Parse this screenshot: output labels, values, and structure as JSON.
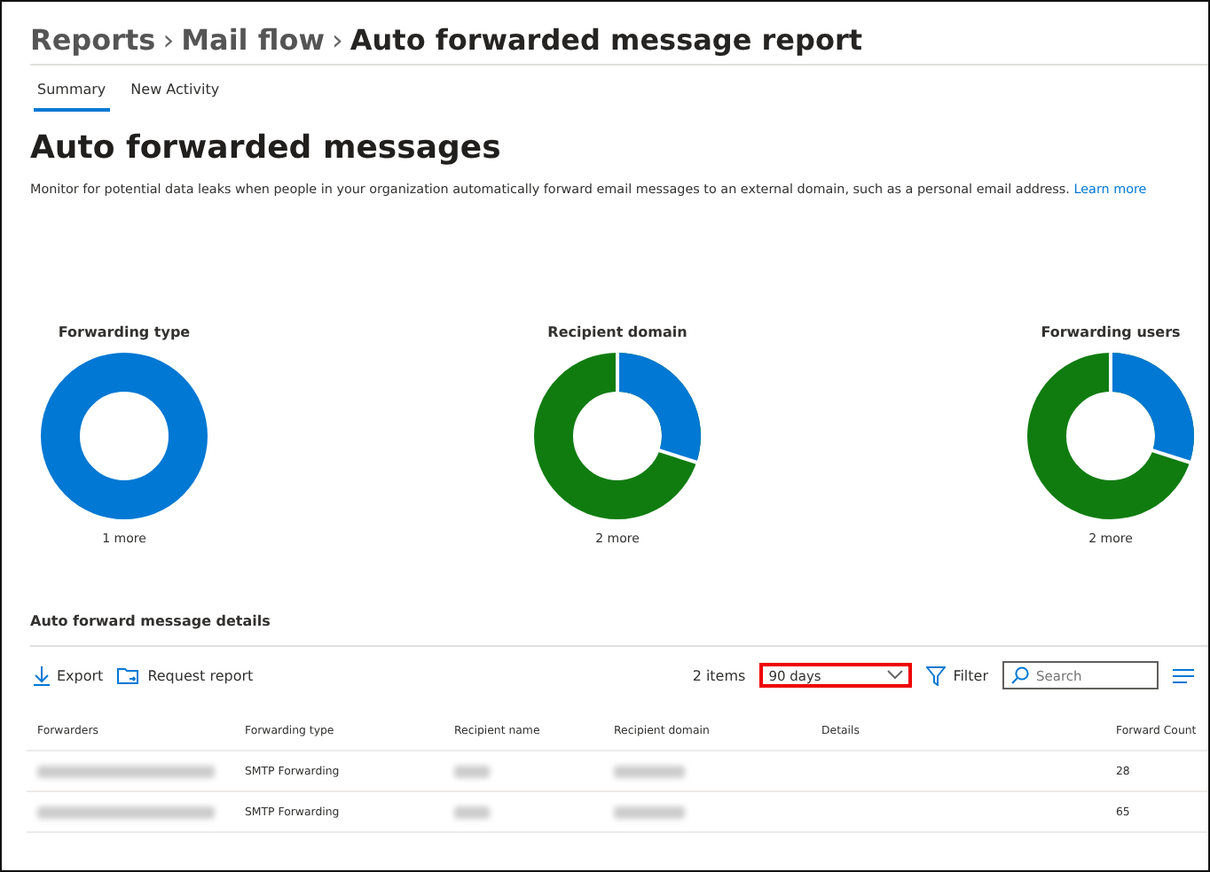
{
  "breadcrumb": {
    "items": [
      "Reports",
      "Mail flow",
      "Auto forwarded message report"
    ],
    "separator": "›"
  },
  "tabs": [
    {
      "label": "Summary",
      "selected": true
    },
    {
      "label": "New Activity",
      "selected": false
    }
  ],
  "heading": "Auto forwarded messages",
  "description": "Monitor for potential data leaks when people in your organization automatically forward email messages to an external domain, such as a personal email address.",
  "learn_more": "Learn more",
  "charts": [
    {
      "title": "Forwarding type",
      "more": "1 more",
      "split": false
    },
    {
      "title": "Recipient domain",
      "more": "2 more",
      "split": true
    },
    {
      "title": "Forwarding users",
      "more": "2 more",
      "split": true
    }
  ],
  "details": {
    "title": "Auto forward message details",
    "export": "Export",
    "request_report": "Request report",
    "items": "2 items",
    "range": "90 days",
    "range_highlighted": true,
    "filter": "Filter",
    "search_placeholder": "Search"
  },
  "table": {
    "columns": [
      "Forwarders",
      "Forwarding type",
      "Recipient name",
      "Recipient domain",
      "Details",
      "Forward Count"
    ],
    "rows": [
      {
        "forwarding_type": "SMTP Forwarding",
        "forward_count": "28"
      },
      {
        "forwarding_type": "SMTP Forwarding",
        "forward_count": "65"
      }
    ]
  }
}
